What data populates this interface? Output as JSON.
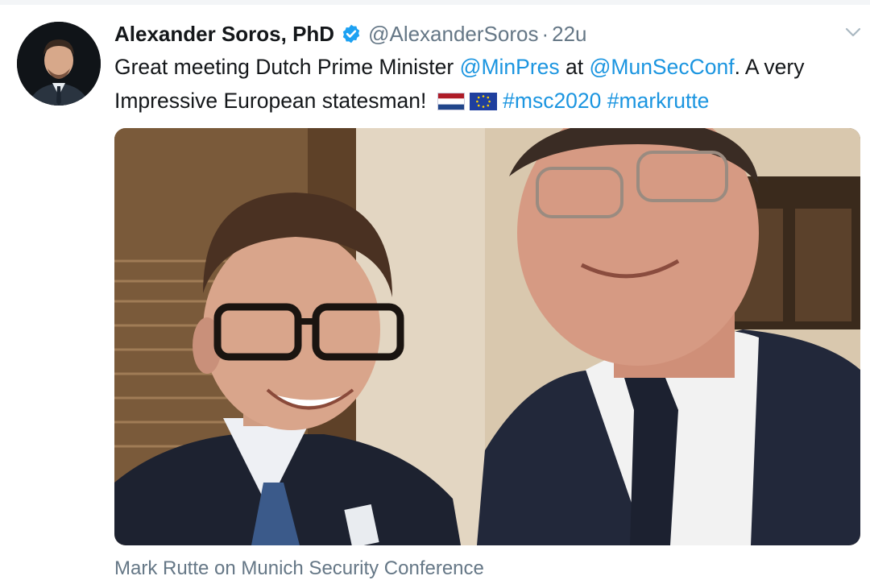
{
  "tweet": {
    "author_name": "Alexander Soros, PhD",
    "handle": "@AlexanderSoros",
    "separator": "·",
    "timestamp": "22u",
    "text": {
      "part1": "Great meeting Dutch Prime Minister ",
      "mention1": "@MinPres",
      "part2": " at ",
      "mention2": "@MunSecConf",
      "part3": ". A very Impressive European statesman! ",
      "hashtag1": "#msc2020",
      "hashtag2": "#markrutte"
    },
    "link_card_title": "Mark Rutte on Munich Security Conference"
  },
  "colors": {
    "link": "#1b95e0",
    "verified": "#1da1f2",
    "secondary_text": "#657786"
  },
  "icons": {
    "verified": "verified-badge-icon",
    "caret": "chevron-down-icon",
    "flag_nl": "netherlands-flag-icon",
    "flag_eu": "eu-flag-icon"
  }
}
